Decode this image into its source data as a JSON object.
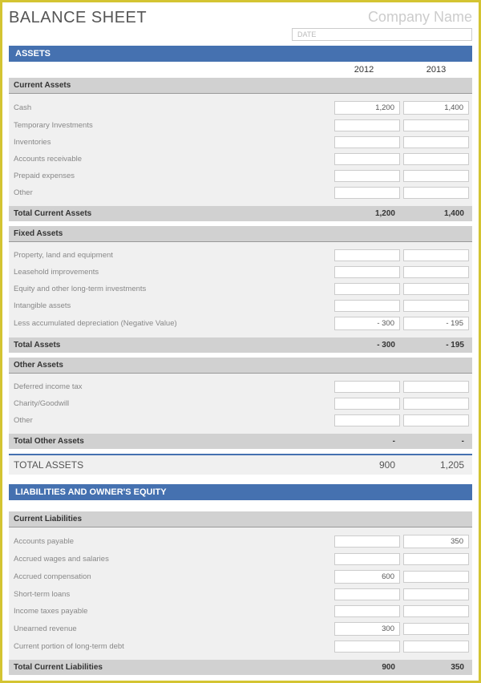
{
  "header": {
    "title": "BALANCE SHEET",
    "company_placeholder": "Company Name",
    "date_placeholder": "DATE"
  },
  "years": {
    "y1": "2012",
    "y2": "2013"
  },
  "sections": {
    "assets_header": "ASSETS",
    "liab_header": "LIABILITIES AND OWNER'S EQUITY"
  },
  "current_assets": {
    "header": "Current Assets",
    "rows": [
      {
        "label": "Cash",
        "v1": "1,200",
        "v2": "1,400"
      },
      {
        "label": "Temporary Investments",
        "v1": "",
        "v2": ""
      },
      {
        "label": "Inventories",
        "v1": "",
        "v2": ""
      },
      {
        "label": "Accounts receivable",
        "v1": "",
        "v2": ""
      },
      {
        "label": "Prepaid expenses",
        "v1": "",
        "v2": ""
      },
      {
        "label": "Other",
        "v1": "",
        "v2": ""
      }
    ],
    "total_label": "Total Current Assets",
    "t1": "1,200",
    "t2": "1,400"
  },
  "fixed_assets": {
    "header": "Fixed Assets",
    "rows": [
      {
        "label": "Property, land and equipment",
        "v1": "",
        "v2": ""
      },
      {
        "label": "Leasehold improvements",
        "v1": "",
        "v2": ""
      },
      {
        "label": "Equity and other long-term investments",
        "v1": "",
        "v2": ""
      },
      {
        "label": "Intangible assets",
        "v1": "",
        "v2": ""
      },
      {
        "label": "Less accumulated depreciation (Negative Value)",
        "v1": "- 300",
        "v2": "- 195"
      }
    ],
    "total_label": "Total Assets",
    "t1": "- 300",
    "t2": "- 195"
  },
  "other_assets": {
    "header": "Other Assets",
    "rows": [
      {
        "label": "Deferred income tax",
        "v1": "",
        "v2": ""
      },
      {
        "label": "Charity/Goodwill",
        "v1": "",
        "v2": ""
      },
      {
        "label": "Other",
        "v1": "",
        "v2": ""
      }
    ],
    "total_label": "Total Other Assets",
    "t1": "-",
    "t2": "-"
  },
  "total_assets": {
    "label": "TOTAL ASSETS",
    "v1": "900",
    "v2": "1,205"
  },
  "current_liab": {
    "header": "Current Liabilities",
    "rows": [
      {
        "label": "Accounts payable",
        "v1": "",
        "v2": "350"
      },
      {
        "label": "Accrued wages and salaries",
        "v1": "",
        "v2": ""
      },
      {
        "label": "Accrued compensation",
        "v1": "600",
        "v2": ""
      },
      {
        "label": "Short-term loans",
        "v1": "",
        "v2": ""
      },
      {
        "label": "Income taxes payable",
        "v1": "",
        "v2": ""
      },
      {
        "label": "Unearned revenue",
        "v1": "300",
        "v2": ""
      },
      {
        "label": "Current portion of long-term debt",
        "v1": "",
        "v2": ""
      }
    ],
    "total_label": "Total Current Liabilities",
    "t1": "900",
    "t2": "350"
  }
}
